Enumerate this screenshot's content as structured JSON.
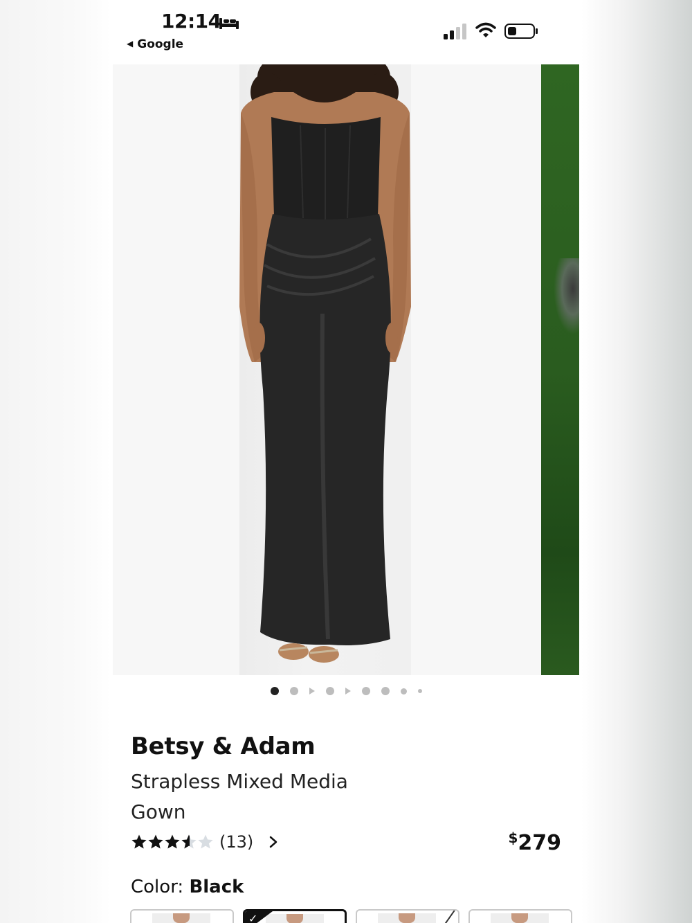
{
  "status_bar": {
    "time": "12:14",
    "back_app": "Google",
    "icons": [
      "bed-icon",
      "signal-icon",
      "wifi-icon",
      "battery-icon"
    ]
  },
  "gallery": {
    "image_count": 9,
    "active_index": 0,
    "dots": [
      "active",
      "norm",
      "play",
      "norm",
      "play",
      "norm",
      "norm",
      "small-norm",
      "small"
    ]
  },
  "product": {
    "brand": "Betsy & Adam",
    "name": "Strapless Mixed Media Gown",
    "rating_stars": 3.5,
    "review_count": "(13)",
    "price_currency": "$",
    "price_amount": "279",
    "color_label": "Color:",
    "color_value": "Black"
  },
  "swatches": [
    {
      "name": "swatch-1",
      "selected": false
    },
    {
      "name": "swatch-black",
      "selected": true
    },
    {
      "name": "swatch-3",
      "selected": false
    },
    {
      "name": "swatch-4",
      "selected": false
    }
  ],
  "colors": {
    "accent": "#111111",
    "star_filled": "#111111",
    "star_empty": "#d8dde2"
  }
}
